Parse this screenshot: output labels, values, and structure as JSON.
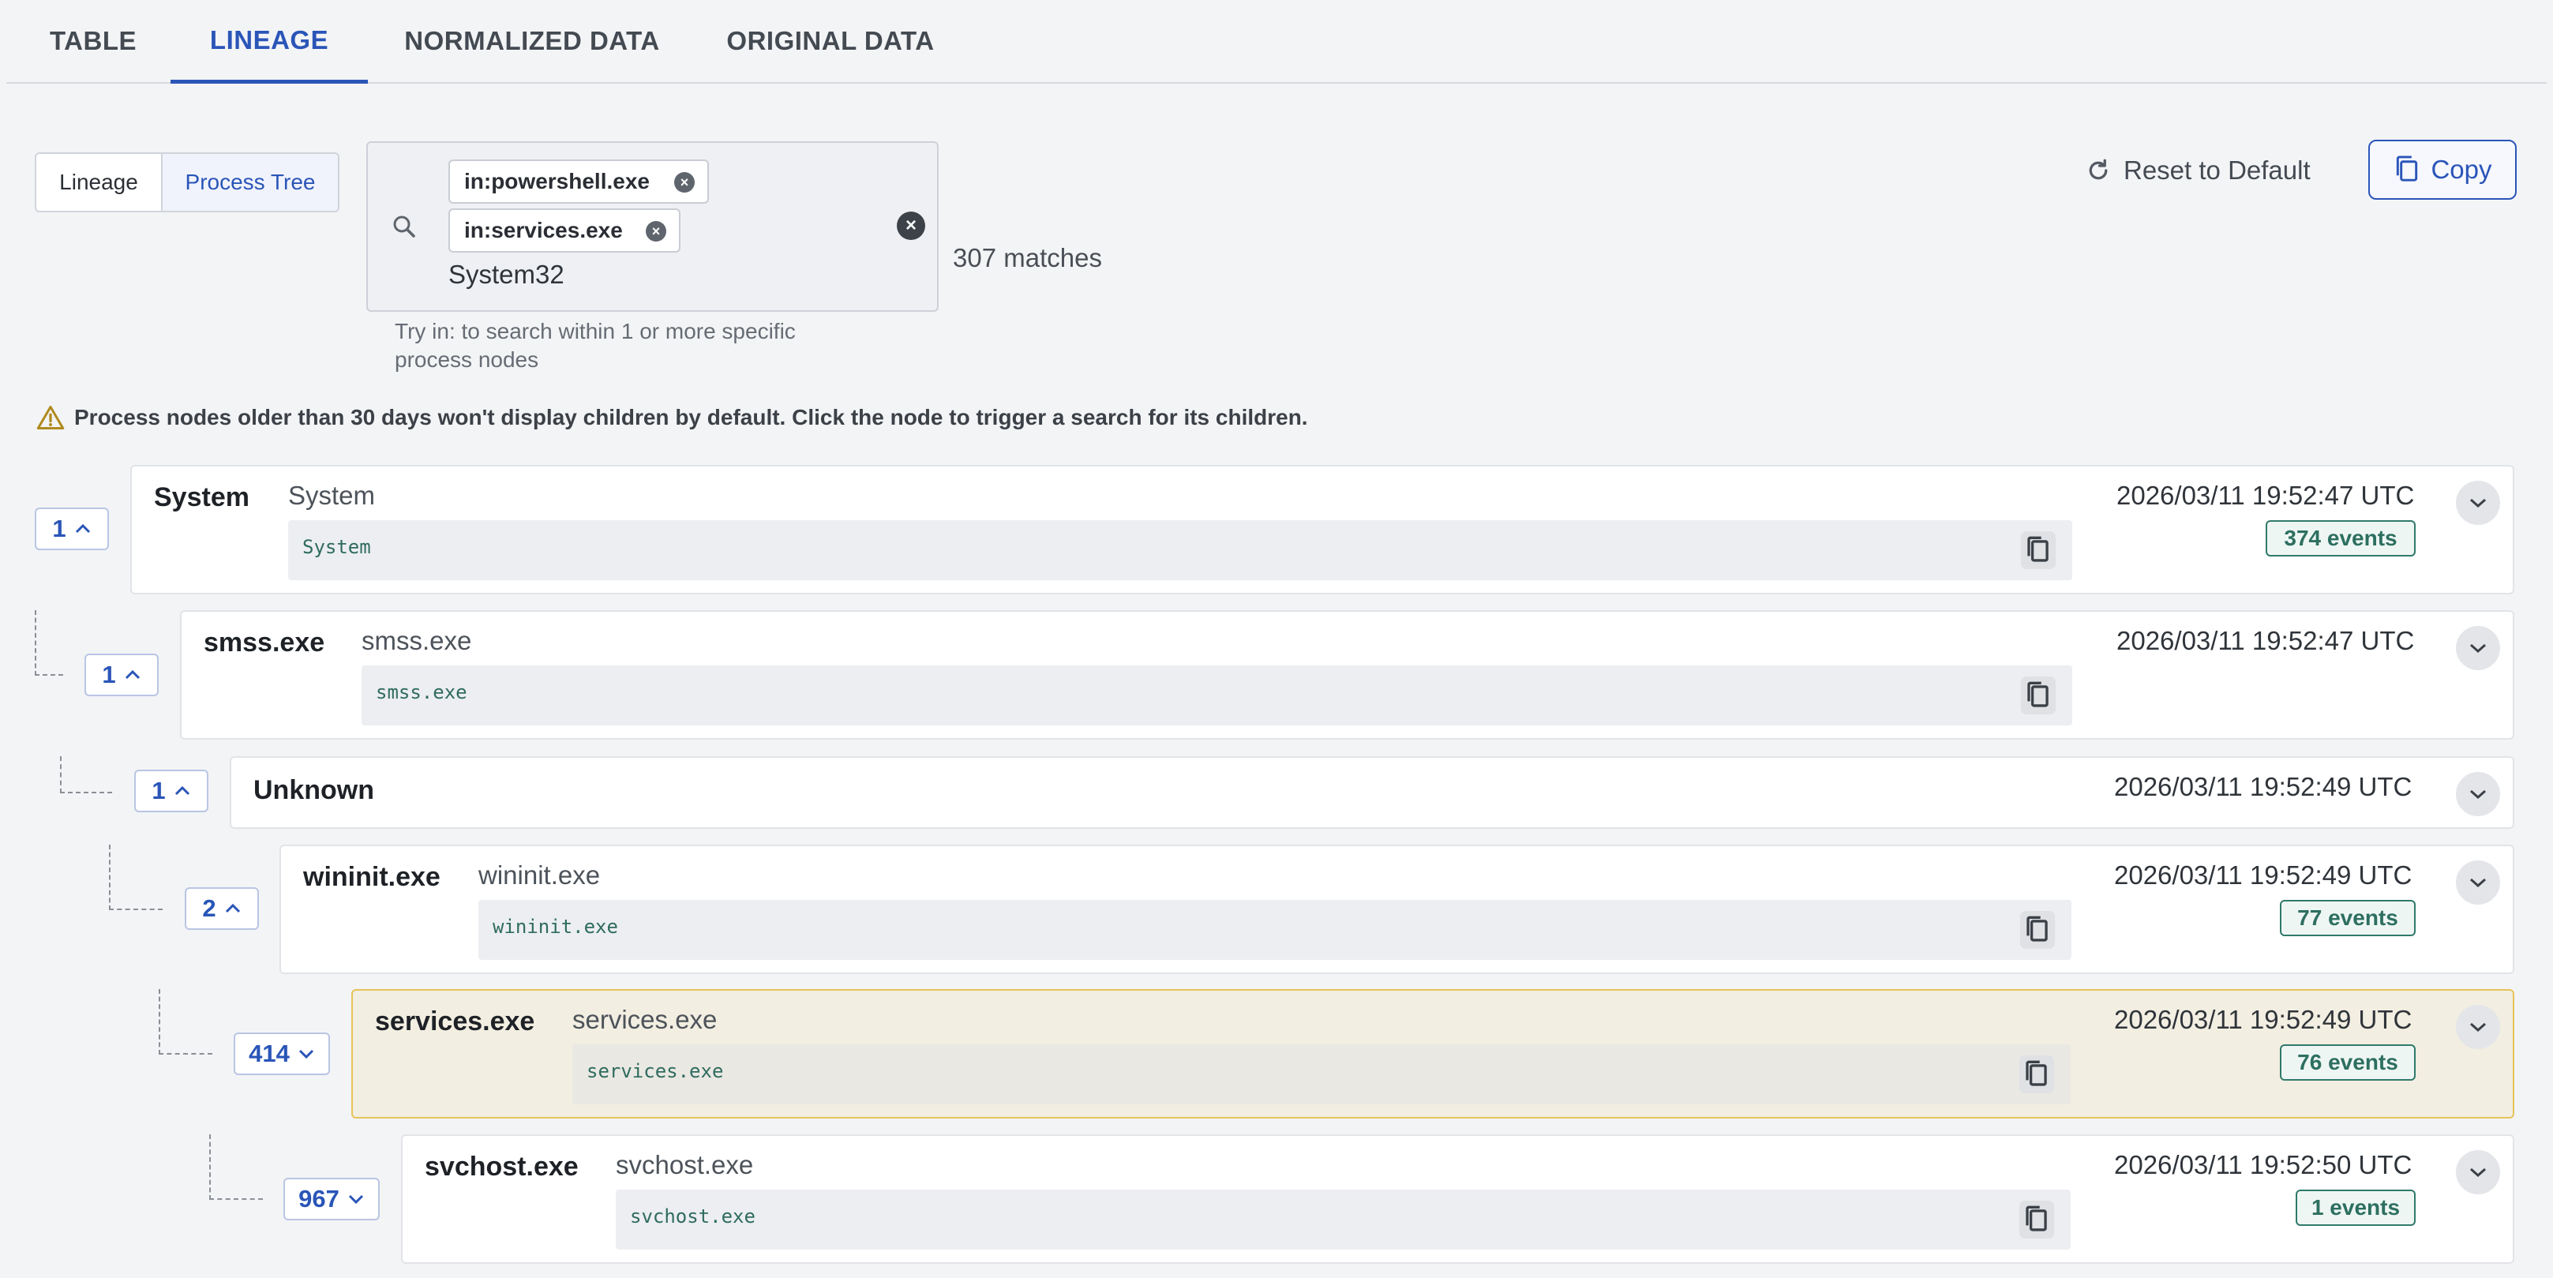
{
  "tabs": [
    "TABLE",
    "LINEAGE",
    "NORMALIZED DATA",
    "ORIGINAL DATA"
  ],
  "active_tab": "LINEAGE",
  "view_toggle": {
    "lineage": "Lineage",
    "process_tree": "Process Tree",
    "selected": "Process Tree"
  },
  "search": {
    "chips": [
      "in:powershell.exe",
      "in:services.exe"
    ],
    "query": "System32",
    "hint": "Try in: to search within 1 or more specific process nodes",
    "matches": "307 matches"
  },
  "actions": {
    "reset": "Reset to Default",
    "copy": "Copy"
  },
  "warning": "Process nodes older than 30 days won't display children by default. Click the node to trigger a search for its children.",
  "nodes": [
    {
      "count": "1",
      "name": "System",
      "subtitle": "System",
      "cmd": "System",
      "time": "2026/03/11 19:52:47 UTC",
      "events": "374 events",
      "expanded": true
    },
    {
      "count": "1",
      "name": "smss.exe",
      "subtitle": "smss.exe",
      "cmd": "smss.exe",
      "time": "2026/03/11 19:52:47 UTC",
      "events": "",
      "expanded": true
    },
    {
      "count": "1",
      "name": "Unknown",
      "subtitle": "",
      "cmd": "",
      "time": "2026/03/11 19:52:49 UTC",
      "events": "",
      "expanded": true
    },
    {
      "count": "2",
      "name": "wininit.exe",
      "subtitle": "wininit.exe",
      "cmd": "wininit.exe",
      "time": "2026/03/11 19:52:49 UTC",
      "events": "77 events",
      "expanded": true
    },
    {
      "count": "414",
      "name": "services.exe",
      "subtitle": "services.exe",
      "cmd": "services.exe",
      "time": "2026/03/11 19:52:49 UTC",
      "events": "76 events",
      "expanded": false,
      "highlighted": true
    },
    {
      "count": "967",
      "name": "svchost.exe",
      "subtitle": "svchost.exe",
      "cmd": "svchost.exe",
      "time": "2026/03/11 19:52:50 UTC",
      "events": "1 events",
      "expanded": false
    }
  ],
  "colors": {
    "accent": "#2a55b8",
    "badge": "#2f7a6a",
    "highlight_bg": "#f2eee1",
    "highlight_border": "#e6c35a"
  }
}
